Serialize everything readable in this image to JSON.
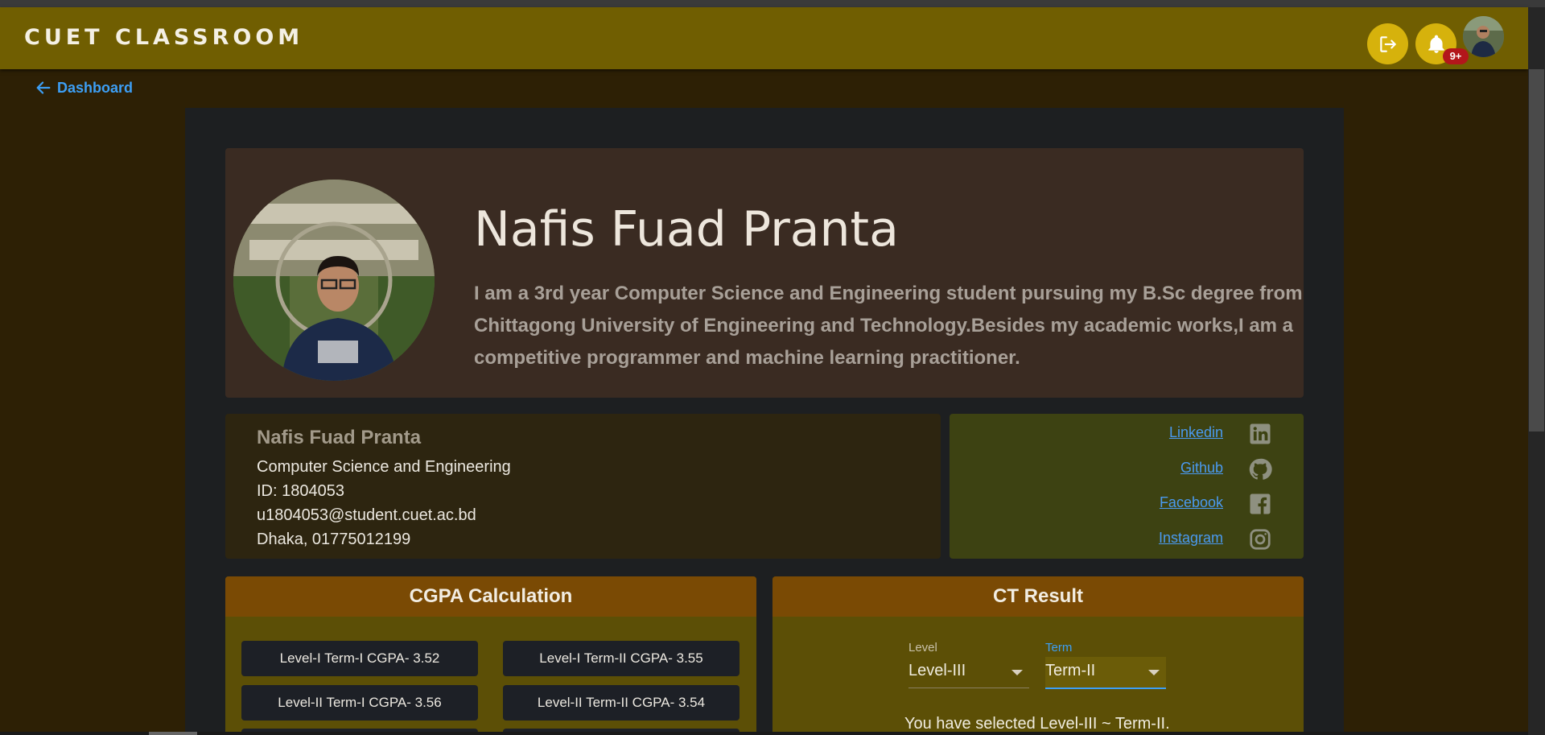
{
  "app": {
    "brand": "CUET CLASSROOM",
    "notification_count": "9+"
  },
  "nav": {
    "back_label": "Dashboard"
  },
  "profile": {
    "name": "Nafis Fuad Pranta",
    "bio": "I am a 3rd year Computer Science and Engineering student pursuing my B.Sc degree from Chittagong University of Engineering and Technology.Besides my academic works,I am a competitive programmer and machine learning practitioner.",
    "department": "Computer Science and Engineering",
    "id_line": "ID: 1804053",
    "email": "u1804053@student.cuet.ac.bd",
    "location_phone": "Dhaka, 01775012199"
  },
  "social": {
    "links": [
      {
        "label": "Linkedin",
        "icon": "linkedin-icon"
      },
      {
        "label": "Github",
        "icon": "github-icon"
      },
      {
        "label": "Facebook",
        "icon": "facebook-icon"
      },
      {
        "label": "Instagram",
        "icon": "instagram-icon"
      }
    ]
  },
  "cgpa": {
    "title": "CGPA Calculation",
    "items": [
      "Level-I Term-I CGPA- 3.52",
      "Level-I Term-II CGPA- 3.55",
      "Level-II Term-I CGPA- 3.56",
      "Level-II Term-II CGPA- 3.54"
    ]
  },
  "ct": {
    "title": "CT Result",
    "level_label": "Level",
    "level_value": "Level-III",
    "term_label": "Term",
    "term_value": "Term-II",
    "selected_message": "You have selected Level-III ~ Term-II."
  },
  "colors": {
    "appbar": "#705e01",
    "accent_link": "#3d9ff5",
    "action_button": "#d6b20c",
    "badge": "#b3161b",
    "term_label_active": "#3d9ff5"
  }
}
